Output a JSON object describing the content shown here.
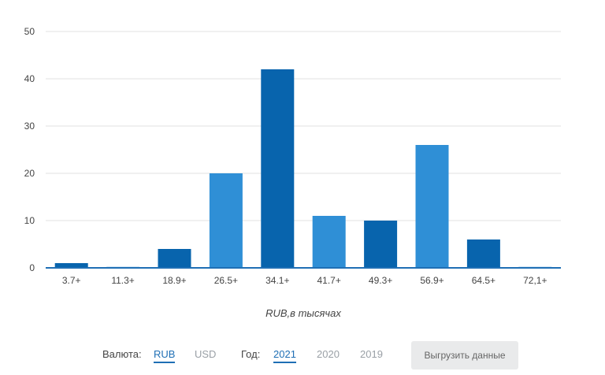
{
  "chart_data": {
    "type": "bar",
    "categories": [
      "3.7+",
      "11.3+",
      "18.9+",
      "26.5+",
      "34.1+",
      "41.7+",
      "49.3+",
      "56.9+",
      "64.5+",
      "72,1+"
    ],
    "values": [
      1,
      0.2,
      4,
      20,
      42,
      11,
      10,
      26,
      6,
      0.2
    ],
    "bar_colors": [
      "#0864ad",
      "#2f8fd6",
      "#0864ad",
      "#2f8fd6",
      "#0864ad",
      "#2f8fd6",
      "#0864ad",
      "#2f8fd6",
      "#0864ad",
      "#2f8fd6"
    ],
    "ylim": [
      0,
      50
    ],
    "yticks": [
      0,
      10,
      20,
      30,
      40,
      50
    ],
    "xlabel": "RUB,в тысячах",
    "ylabel": "",
    "title": "",
    "grid": true
  },
  "controls": {
    "currency_label": "Валюта:",
    "currency_options": [
      "RUB",
      "USD"
    ],
    "currency_selected": "RUB",
    "year_label": "Год:",
    "year_options": [
      "2021",
      "2020",
      "2019"
    ],
    "year_selected": "2021",
    "export_label": "Выгрузить данные"
  }
}
